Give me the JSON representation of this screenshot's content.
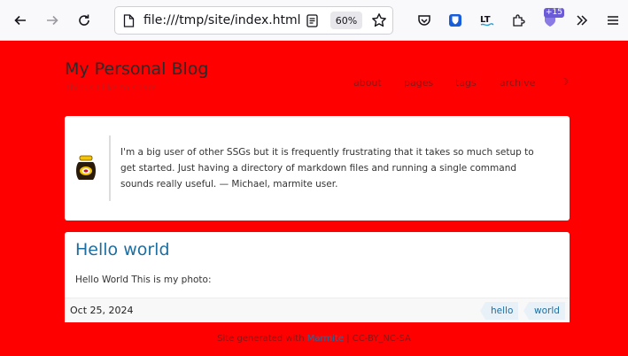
{
  "browser": {
    "url": "file:///tmp/site/index.html",
    "zoom": "60%",
    "extensions_badge": "+15"
  },
  "site": {
    "title": "My Personal Blog",
    "tagline": "Things I like to share"
  },
  "nav": {
    "items": [
      "about",
      "pages",
      "tags",
      "archive"
    ]
  },
  "quote": {
    "text": "I'm a big user of other SSGs but it is frequently frustrating that it takes so much setup to get started. Just having a directory of markdown files and running a single command sounds really useful. — Michael, marmite user."
  },
  "post": {
    "title": "Hello world",
    "body": "Hello World This is my photo:",
    "date": "Oct 25, 2024",
    "tags": [
      "hello",
      "world"
    ]
  },
  "footer": {
    "prefix": "Site generated with",
    "link": "Marmite",
    "license": " | CC-BY_NC-SA"
  },
  "colors": {
    "page_background": "#ff0000",
    "link": "#1d6ea0"
  }
}
